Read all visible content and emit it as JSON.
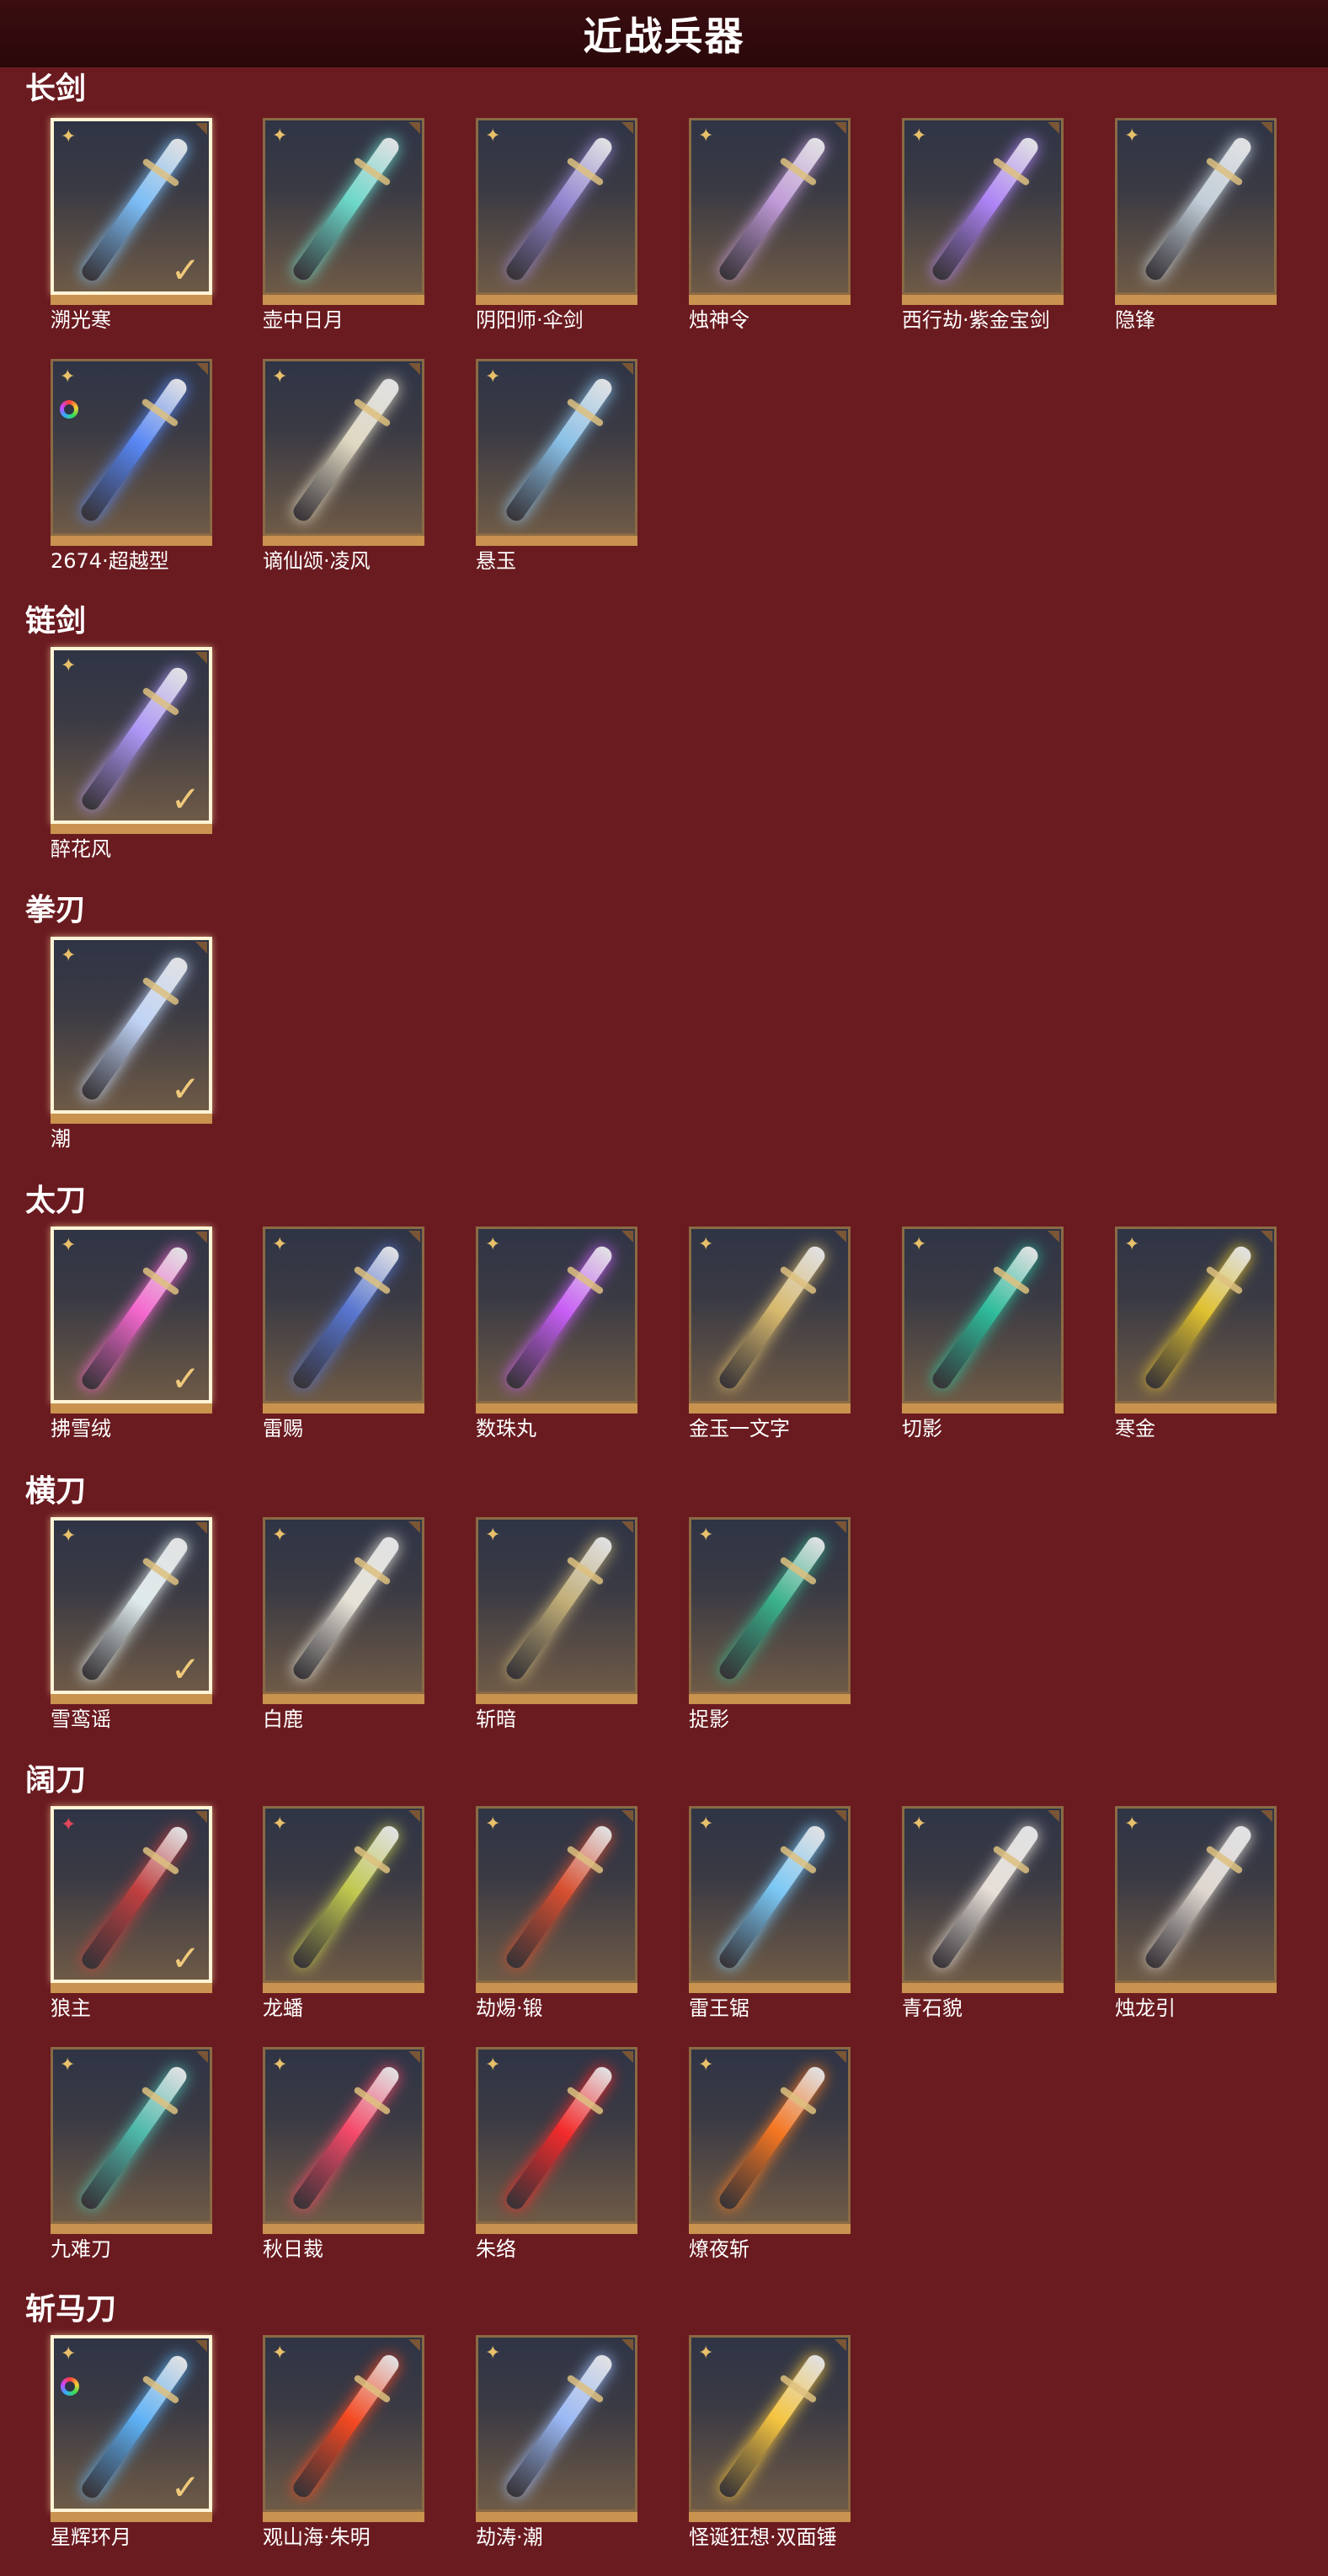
{
  "title": "近战兵器",
  "sections": [
    {
      "name": "长剑",
      "items": [
        {
          "name": "溯光寒",
          "selected": true,
          "badge": "gold",
          "color": "#7fc4ff"
        },
        {
          "name": "壶中日月",
          "selected": false,
          "badge": "gold",
          "color": "#6fe0d0"
        },
        {
          "name": "阴阳师·伞剑",
          "selected": false,
          "badge": "gold",
          "color": "#9a8ad8"
        },
        {
          "name": "烛神令",
          "selected": false,
          "badge": "gold",
          "color": "#c8a0e0"
        },
        {
          "name": "西行劫·紫金宝剑",
          "selected": false,
          "badge": "gold",
          "color": "#b488ff"
        },
        {
          "name": "隐锋",
          "selected": false,
          "badge": "gold",
          "color": "#c9d6e0"
        },
        {
          "name": "2674·超越型",
          "selected": false,
          "badge": "gold",
          "ring": true,
          "color": "#5a8cff"
        },
        {
          "name": "谪仙颂·凌风",
          "selected": false,
          "badge": "gold",
          "color": "#e8e0c8"
        },
        {
          "name": "悬玉",
          "selected": false,
          "badge": "gold",
          "color": "#8ec8f0"
        }
      ]
    },
    {
      "name": "链剑",
      "items": [
        {
          "name": "醉花风",
          "selected": true,
          "badge": "gold",
          "color": "#b39cff"
        }
      ]
    },
    {
      "name": "拳刃",
      "items": [
        {
          "name": "潮",
          "selected": true,
          "badge": "gold",
          "color": "#c8dcff"
        }
      ]
    },
    {
      "name": "太刀",
      "items": [
        {
          "name": "拂雪绒",
          "selected": true,
          "badge": "gold",
          "color": "#ff6ad5"
        },
        {
          "name": "雷赐",
          "selected": false,
          "badge": "gold",
          "color": "#5a7ad8"
        },
        {
          "name": "数珠丸",
          "selected": false,
          "badge": "gold",
          "color": "#d060ff"
        },
        {
          "name": "金玉一文字",
          "selected": false,
          "badge": "gold",
          "color": "#e0c070"
        },
        {
          "name": "切影",
          "selected": false,
          "badge": "gold",
          "color": "#2ec4a0"
        },
        {
          "name": "寒金",
          "selected": false,
          "badge": "gold",
          "color": "#e8c830"
        }
      ]
    },
    {
      "name": "横刀",
      "items": [
        {
          "name": "雪鸾谣",
          "selected": true,
          "badge": "gold",
          "color": "#e8f4f4"
        },
        {
          "name": "白鹿",
          "selected": false,
          "badge": "gold",
          "color": "#f0ece0"
        },
        {
          "name": "斩暗",
          "selected": false,
          "badge": "gold",
          "color": "#c8b47a"
        },
        {
          "name": "捉影",
          "selected": false,
          "badge": "gold",
          "color": "#3ab890"
        }
      ]
    },
    {
      "name": "阔刀",
      "items": [
        {
          "name": "狼主",
          "selected": true,
          "badge": "red",
          "color": "#c84040"
        },
        {
          "name": "龙蟠",
          "selected": false,
          "badge": "gold",
          "color": "#c8d050"
        },
        {
          "name": "劫焬·锻",
          "selected": false,
          "badge": "gold",
          "color": "#e05030"
        },
        {
          "name": "雷王锯",
          "selected": false,
          "badge": "gold",
          "color": "#7fd0ff"
        },
        {
          "name": "青石貌",
          "selected": false,
          "badge": "gold",
          "color": "#f0e8e0"
        },
        {
          "name": "烛龙引",
          "selected": false,
          "badge": "gold",
          "color": "#e8e0d8"
        },
        {
          "name": "九难刀",
          "selected": false,
          "badge": "gold",
          "color": "#50c0b0"
        },
        {
          "name": "秋日裁",
          "selected": false,
          "badge": "gold",
          "color": "#ff4a6a"
        },
        {
          "name": "朱络",
          "selected": false,
          "badge": "gold",
          "color": "#ff2a2a"
        },
        {
          "name": "燎夜斩",
          "selected": false,
          "badge": "gold",
          "color": "#ff7a20"
        }
      ]
    },
    {
      "name": "斩马刀",
      "items": [
        {
          "name": "星辉环月",
          "selected": true,
          "badge": "gold",
          "ring": true,
          "color": "#60b8ff"
        },
        {
          "name": "观山海·朱明",
          "selected": false,
          "badge": "gold",
          "color": "#ff4a20"
        },
        {
          "name": "劫涛·潮",
          "selected": false,
          "badge": "gold",
          "color": "#a0c0ff"
        },
        {
          "name": "怪诞狂想·双面锤",
          "selected": false,
          "badge": "gold",
          "color": "#ffcc40"
        }
      ]
    }
  ]
}
